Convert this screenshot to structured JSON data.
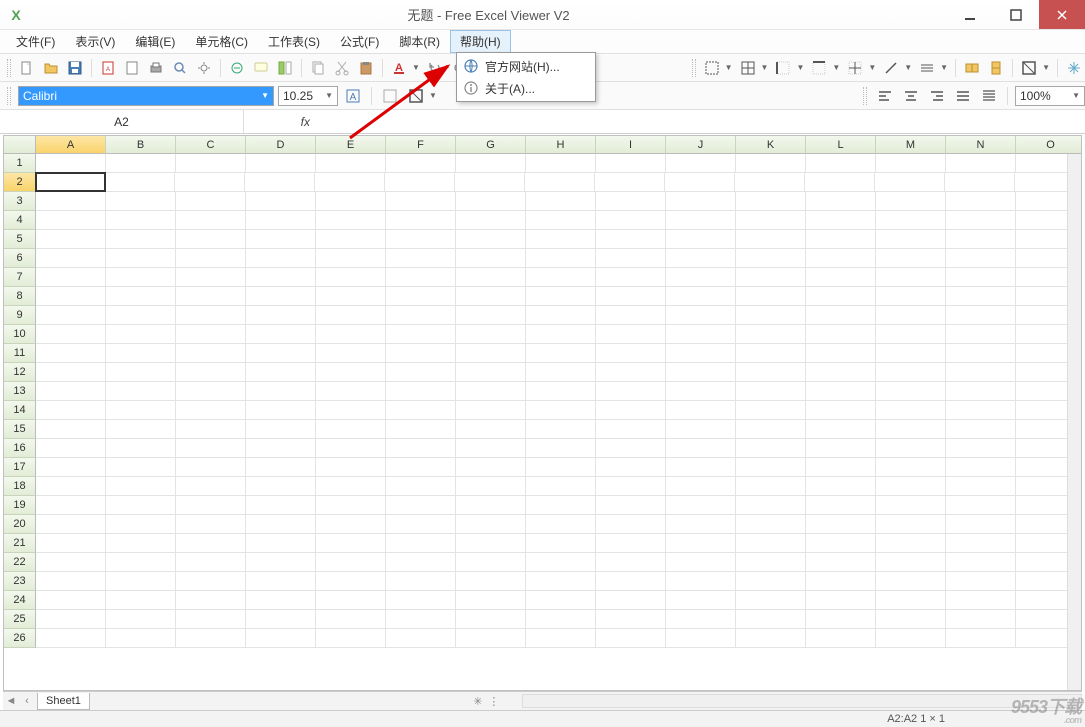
{
  "title": "无题 - Free Excel Viewer V2",
  "menu": {
    "file": "文件(F)",
    "view": "表示(V)",
    "edit": "编辑(E)",
    "cell": "单元格(C)",
    "sheet": "工作表(S)",
    "formula": "公式(F)",
    "script": "脚本(R)",
    "help": "帮助(H)"
  },
  "help_menu": {
    "website": "官方网站(H)...",
    "about": "关于(A)..."
  },
  "font": {
    "name": "Calibri",
    "size": "10.25"
  },
  "zoom": "100%",
  "namebox": "A2",
  "fx_label": "fx",
  "columns": [
    "A",
    "B",
    "C",
    "D",
    "E",
    "F",
    "G",
    "H",
    "I",
    "J",
    "K",
    "L",
    "M",
    "N",
    "O"
  ],
  "rows": [
    "1",
    "2",
    "3",
    "4",
    "5",
    "6",
    "7",
    "8",
    "9",
    "10",
    "11",
    "12",
    "13",
    "14",
    "15",
    "16",
    "17",
    "18",
    "19",
    "20",
    "21",
    "22",
    "23",
    "24",
    "25",
    "26"
  ],
  "active": {
    "col": 0,
    "row": 1
  },
  "sheet_tab": "Sheet1",
  "status_sel": "A2:A2 1 × 1",
  "watermark": "9553下载",
  "watermark_sub": ".com"
}
